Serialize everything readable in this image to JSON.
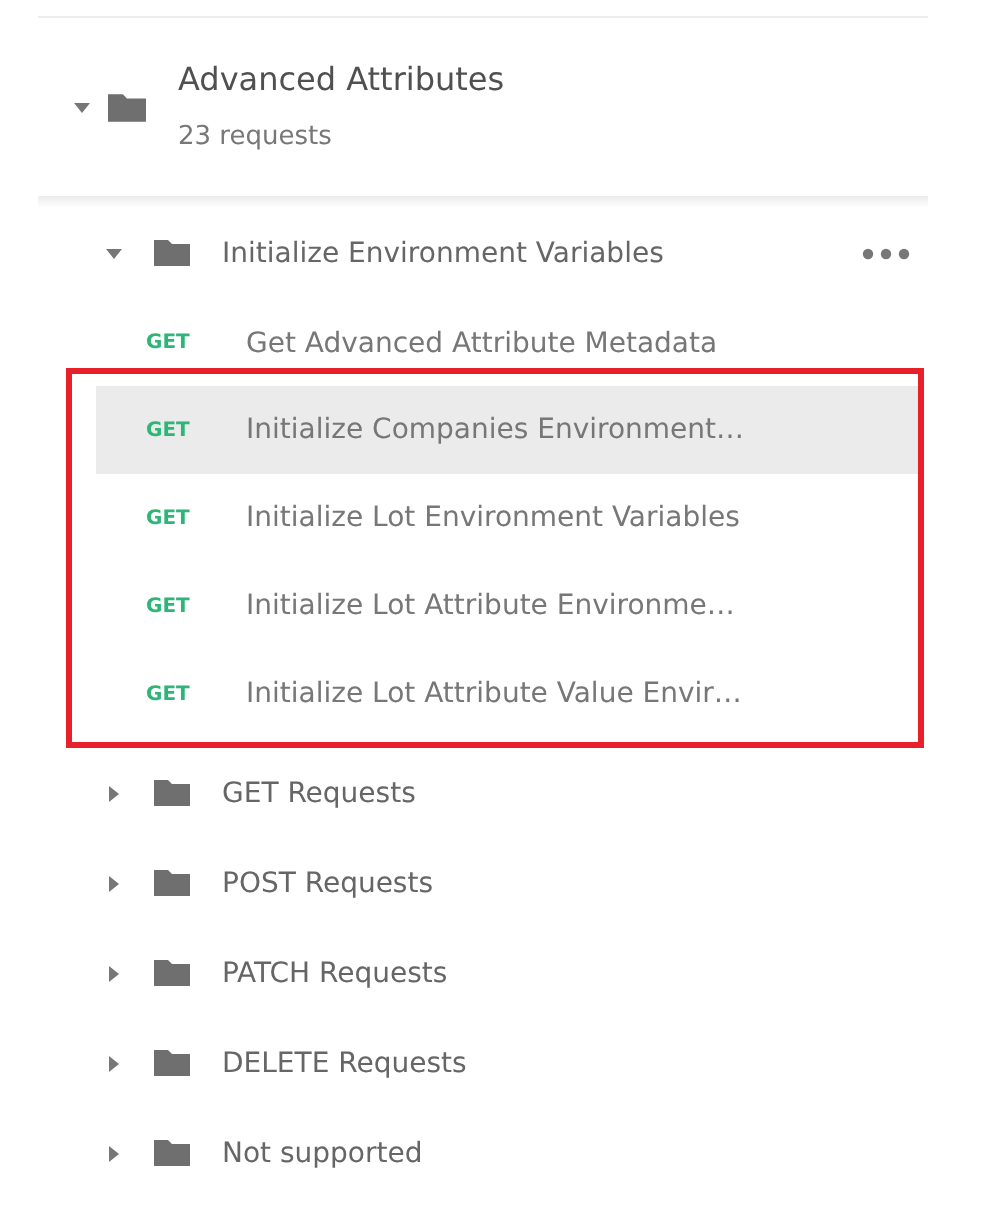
{
  "collection": {
    "name": "Advanced Attributes",
    "count": "23 requests",
    "expanded": true,
    "items": [
      {
        "kind": "folder",
        "name": "Initialize Environment Variables",
        "expanded": true,
        "menu_shown": true,
        "children": [
          {
            "kind": "request",
            "method": "GET",
            "name": "Get Advanced Attribute Metadata",
            "selected": false,
            "highlighted": false
          },
          {
            "kind": "request",
            "method": "GET",
            "name": "Initialize Companies Environment…",
            "selected": true,
            "highlighted": true
          },
          {
            "kind": "request",
            "method": "GET",
            "name": "Initialize Lot Environment Variables",
            "selected": false,
            "highlighted": true
          },
          {
            "kind": "request",
            "method": "GET",
            "name": "Initialize Lot Attribute Environme…",
            "selected": false,
            "highlighted": true
          },
          {
            "kind": "request",
            "method": "GET",
            "name": "Initialize Lot Attribute Value Envir…",
            "selected": false,
            "highlighted": true
          }
        ]
      },
      {
        "kind": "folder",
        "name": "GET Requests",
        "expanded": false,
        "menu_shown": false
      },
      {
        "kind": "folder",
        "name": "POST Requests",
        "expanded": false,
        "menu_shown": false
      },
      {
        "kind": "folder",
        "name": "PATCH Requests",
        "expanded": false,
        "menu_shown": false
      },
      {
        "kind": "folder",
        "name": "DELETE Requests",
        "expanded": false,
        "menu_shown": false
      },
      {
        "kind": "folder",
        "name": "Not supported",
        "expanded": false,
        "menu_shown": false
      }
    ]
  }
}
